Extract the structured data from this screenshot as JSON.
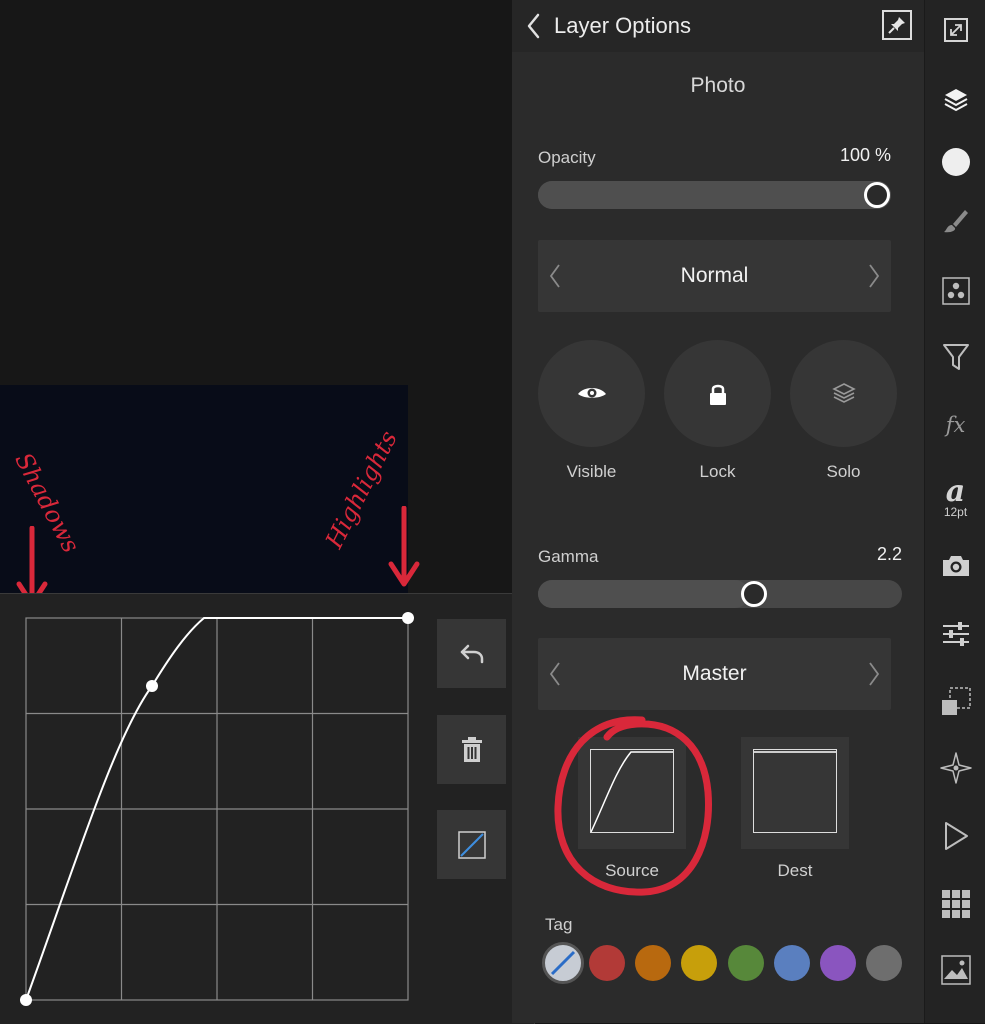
{
  "annotations": {
    "shadows": "Shadows",
    "highlights": "Highlights",
    "color": "#d9283a"
  },
  "panel": {
    "title": "Layer Options",
    "layer_name": "Photo",
    "opacity": {
      "label": "Opacity",
      "value": "100 %",
      "level": 1.0
    },
    "blend_mode": "Normal",
    "toggles": [
      {
        "label": "Visible",
        "icon": "eye-icon"
      },
      {
        "label": "Lock",
        "icon": "lock-icon"
      },
      {
        "label": "Solo",
        "icon": "layers-stack-icon"
      }
    ],
    "gamma": {
      "label": "Gamma",
      "value": "2.2",
      "level": 0.58
    },
    "channel": "Master",
    "ranges": [
      {
        "label": "Source"
      },
      {
        "label": "Dest"
      }
    ],
    "tag": {
      "label": "Tag",
      "colors": [
        "#c7ccd4",
        "#b23a37",
        "#b8690f",
        "#c79f0b",
        "#57883a",
        "#5a7fbf",
        "#8a55bf",
        "#6e6e6e"
      ]
    }
  },
  "toolbar": {
    "tools": [
      {
        "icon": "expand-icon"
      },
      {
        "icon": "layers-icon"
      },
      {
        "icon": "color-icon"
      },
      {
        "icon": "brush-icon"
      },
      {
        "icon": "swatches-icon"
      },
      {
        "icon": "filter-icon"
      },
      {
        "icon": "fx-icon",
        "text": "fx"
      },
      {
        "icon": "text-style-icon",
        "text": "a",
        "caption": "12pt"
      },
      {
        "icon": "camera-icon"
      },
      {
        "icon": "adjustments-icon"
      },
      {
        "icon": "transform-icon"
      },
      {
        "icon": "navigator-icon"
      },
      {
        "icon": "play-icon"
      },
      {
        "icon": "grid-icon"
      },
      {
        "icon": "image-icon"
      }
    ]
  },
  "curves": {
    "buttons": [
      "undo-icon",
      "trash-icon",
      "curve-reset-icon"
    ]
  }
}
